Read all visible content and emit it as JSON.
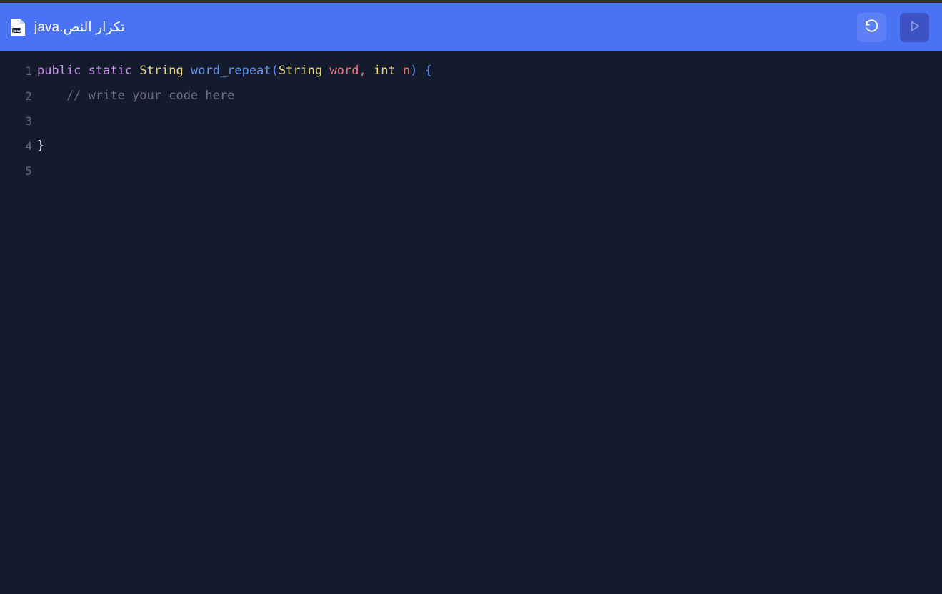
{
  "window": {
    "background_color": "#141b2d",
    "top_strip_color": "#2e2e2e"
  },
  "header": {
    "background_color": "#4a72f5",
    "file_icon_name": "java-file-icon",
    "file_icon_label": "java",
    "title": "تكرار النص.java",
    "buttons": [
      {
        "name": "reset-button",
        "icon": "reset-counterclockwise-arrow-icon",
        "label": "",
        "background_color": "#5d80f7",
        "enabled": true
      },
      {
        "name": "run-button",
        "icon": "play-triangle-icon",
        "label": "",
        "background_color": "#3c51c4",
        "enabled": false
      }
    ]
  },
  "editor": {
    "language": "java",
    "background_color": "#141b2d",
    "gutter_color": "#5d6676",
    "lines": [
      {
        "number": "1",
        "tokens": [
          {
            "text": "public",
            "cls": "t-kw"
          },
          {
            "text": " ",
            "cls": "t-plain"
          },
          {
            "text": "static",
            "cls": "t-kw"
          },
          {
            "text": " ",
            "cls": "t-plain"
          },
          {
            "text": "String",
            "cls": "t-type"
          },
          {
            "text": " ",
            "cls": "t-plain"
          },
          {
            "text": "word_repeat",
            "cls": "t-fn"
          },
          {
            "text": "(",
            "cls": "t-punct"
          },
          {
            "text": "String",
            "cls": "t-type"
          },
          {
            "text": " ",
            "cls": "t-plain"
          },
          {
            "text": "word",
            "cls": "t-var"
          },
          {
            "text": ",",
            "cls": "t-var"
          },
          {
            "text": " ",
            "cls": "t-plain"
          },
          {
            "text": "int",
            "cls": "t-type"
          },
          {
            "text": " ",
            "cls": "t-plain"
          },
          {
            "text": "n",
            "cls": "t-var"
          },
          {
            "text": ")",
            "cls": "t-punct"
          },
          {
            "text": " ",
            "cls": "t-plain"
          },
          {
            "text": "{",
            "cls": "t-punct"
          }
        ]
      },
      {
        "number": "2",
        "tokens": [
          {
            "text": "    // write your code here",
            "cls": "t-comment"
          }
        ]
      },
      {
        "number": "3",
        "tokens": []
      },
      {
        "number": "4",
        "tokens": [
          {
            "text": "}",
            "cls": "t-plain"
          }
        ]
      },
      {
        "number": "5",
        "tokens": []
      }
    ]
  }
}
